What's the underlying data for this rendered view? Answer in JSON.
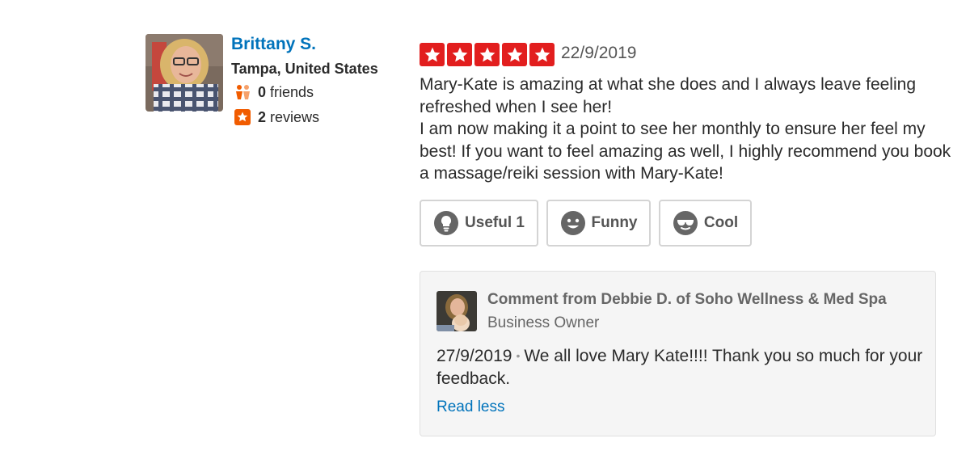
{
  "reviewer": {
    "name": "Brittany S.",
    "location": "Tampa, United States",
    "friends_count": "0",
    "friends_label": "friends",
    "reviews_count": "2",
    "reviews_label": "reviews"
  },
  "review": {
    "rating": 5,
    "max_rating": 5,
    "star_color": "#e21e1e",
    "date": "22/9/2019",
    "paragraphs": [
      "Mary-Kate is amazing at what she does and I always leave feeling refreshed when I see her!",
      "I am now making it a point to see her monthly to ensure her feel my best! If you want to feel amazing as well, I highly recommend you book a massage/reiki session with Mary-Kate!"
    ]
  },
  "votes": {
    "useful_label": "Useful",
    "useful_count": "1",
    "funny_label": "Funny",
    "cool_label": "Cool",
    "icons": [
      "lightbulb-icon",
      "smiley-icon",
      "sunglasses-icon"
    ]
  },
  "owner_comment": {
    "title": "Comment from Debbie D. of Soho Wellness & Med Spa",
    "role": "Business Owner",
    "date": "27/9/2019",
    "text": "We all love Mary Kate!!!! Thank you so much for your feedback.",
    "read_less_label": "Read less"
  },
  "colors": {
    "link": "#0073bb",
    "star_red": "#e21e1e",
    "friends_icon": "#f15c00",
    "reviews_icon": "#f15c00"
  }
}
